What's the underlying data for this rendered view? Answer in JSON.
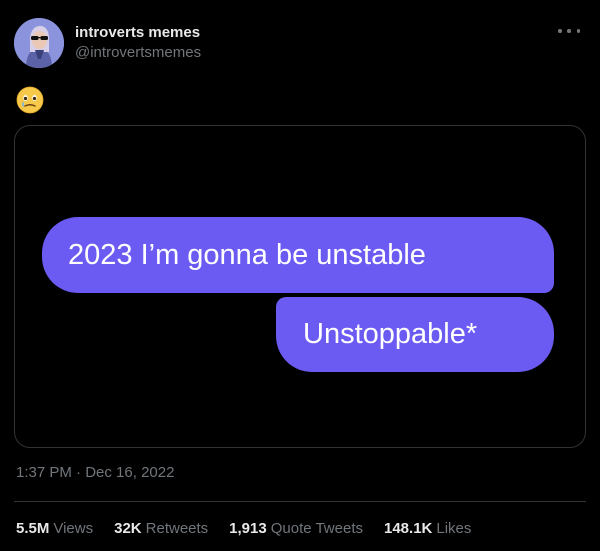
{
  "author": {
    "display_name": "introverts memes",
    "handle": "@introvertsmemes"
  },
  "tweet": {
    "emoji_icon": "face-holding-back-tears-emoji"
  },
  "media": {
    "message_1": "2023 I’m gonna be unstable",
    "message_2": "Unstoppable*",
    "bubble_color": "#6b5bf2"
  },
  "meta": {
    "time": "1:37 PM",
    "separator": "·",
    "date": "Dec 16, 2022"
  },
  "stats": [
    {
      "value": "5.5M",
      "label": "Views"
    },
    {
      "value": "32K",
      "label": "Retweets"
    },
    {
      "value": "1,913",
      "label": "Quote Tweets"
    },
    {
      "value": "148.1K",
      "label": "Likes"
    }
  ],
  "colors": {
    "background": "#000000",
    "text_primary": "#e7e9ea",
    "text_secondary": "#71767b",
    "border": "#2f3336"
  }
}
